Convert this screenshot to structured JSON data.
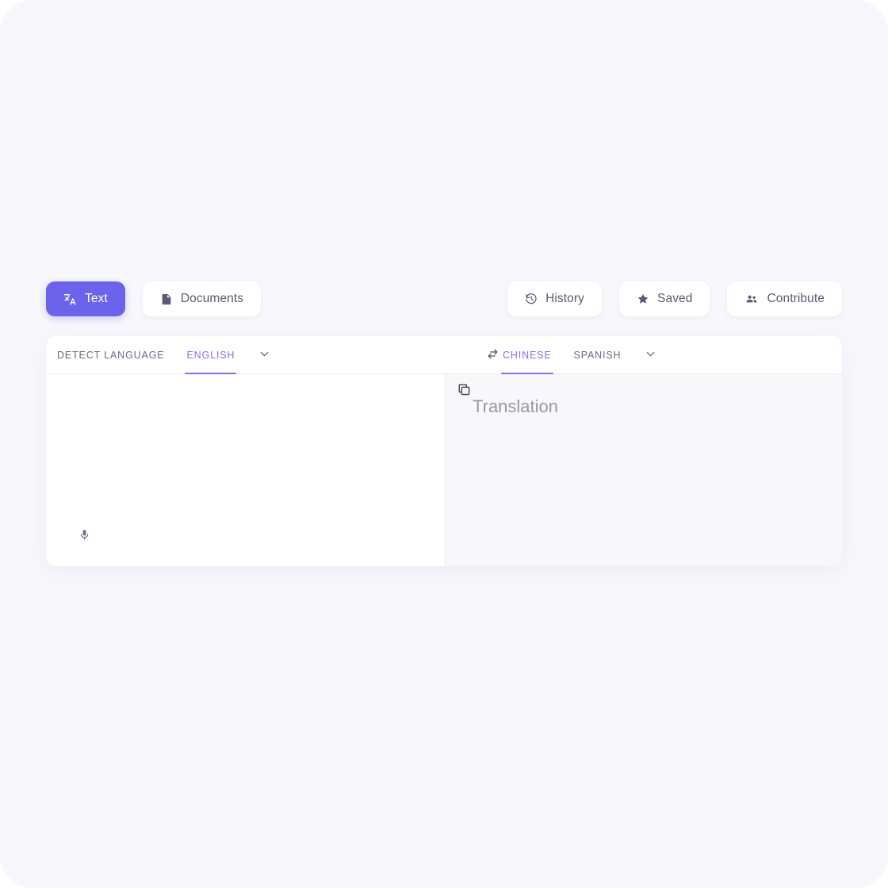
{
  "theme": {
    "accent": "#6c63ec",
    "accent_soft": "#7b72ec",
    "page_bg": "#f7f7fc",
    "card_bg": "#ffffff",
    "target_pane_bg": "#f8f8fa",
    "text_muted": "#6a6a80",
    "placeholder": "#9797aa"
  },
  "toolbar": {
    "left": [
      {
        "label": "Text",
        "icon": "translate-icon",
        "active": true
      },
      {
        "label": "Documents",
        "icon": "document-icon",
        "active": false
      }
    ],
    "right": [
      {
        "label": "History",
        "icon": "history-icon"
      },
      {
        "label": "Saved",
        "icon": "star-icon"
      },
      {
        "label": "Contribute",
        "icon": "people-icon"
      }
    ]
  },
  "translator": {
    "source": {
      "tabs": [
        {
          "label": "Detect language",
          "active": false
        },
        {
          "label": "English",
          "active": true
        }
      ],
      "dropdown_icon": "chevron-down-icon",
      "input_value": "",
      "input_placeholder": "",
      "mic_icon": "microphone-icon"
    },
    "swap": {
      "icon": "swap-horizontal-icon"
    },
    "target": {
      "tabs": [
        {
          "label": "Chinese",
          "active": true
        },
        {
          "label": "Spanish",
          "active": false
        }
      ],
      "dropdown_icon": "chevron-down-icon",
      "copy_icon": "copy-icon",
      "placeholder": "Translation"
    }
  }
}
